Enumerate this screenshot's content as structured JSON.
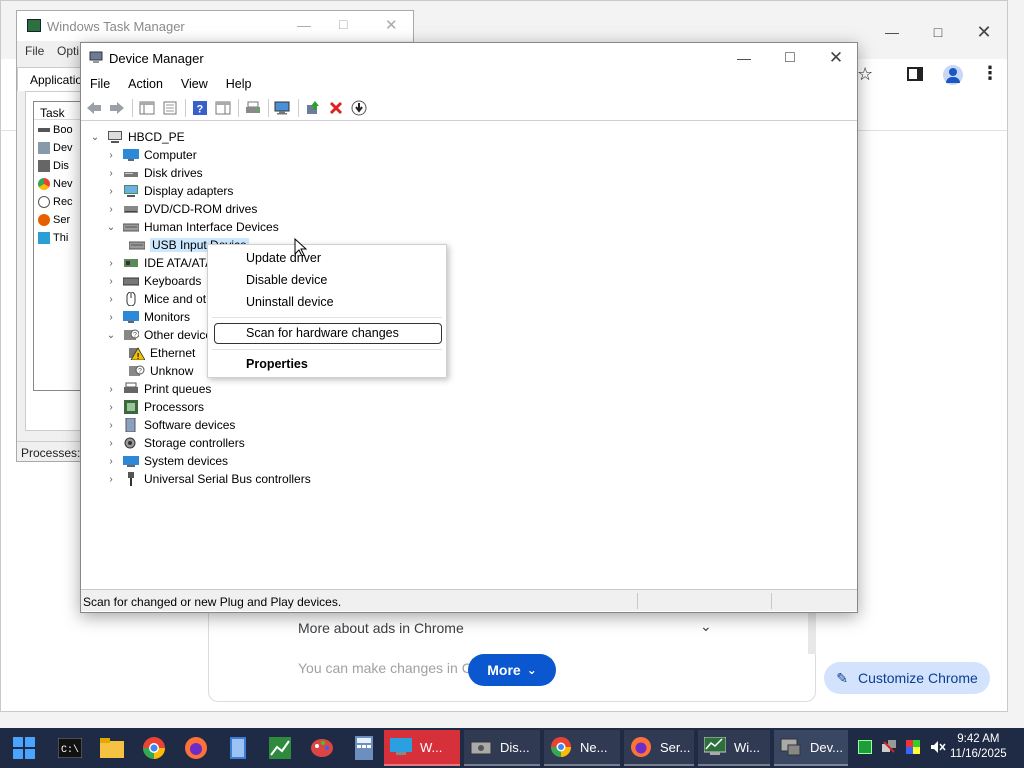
{
  "chrome": {
    "ads_row_text": "More about ads in Chrome",
    "changes_text": "You can make changes in Chro",
    "more_button": "More",
    "customize_button": "Customize Chrome",
    "colors": {
      "accent": "#0b57d0",
      "customize_bg": "#d3e3fd"
    }
  },
  "task_manager": {
    "title": "Windows Task Manager",
    "menu": [
      "File",
      "Opti"
    ],
    "tab_label": "Applicatio",
    "list_header": "Task",
    "list_items": [
      "Boo",
      "Dev",
      "Dis",
      "Nev",
      "Rec",
      "Ser",
      "Thi"
    ],
    "status_text": "Processes: "
  },
  "device_manager": {
    "title": "Device Manager",
    "menu": [
      "File",
      "Action",
      "View",
      "Help"
    ],
    "tree": {
      "root": "HBCD_PE",
      "nodes": [
        {
          "label": "Computer",
          "expanded": false
        },
        {
          "label": "Disk drives",
          "expanded": false
        },
        {
          "label": "Display adapters",
          "expanded": false
        },
        {
          "label": "DVD/CD-ROM drives",
          "expanded": false
        },
        {
          "label": "Human Interface Devices",
          "expanded": true
        },
        {
          "label": "USB Input Device",
          "child": true,
          "selected": true
        },
        {
          "label": "IDE ATA/ATA",
          "expanded": false
        },
        {
          "label": "Keyboards",
          "expanded": false
        },
        {
          "label": "Mice and ot",
          "expanded": false
        },
        {
          "label": "Monitors",
          "expanded": false
        },
        {
          "label": "Other device",
          "expanded": true
        },
        {
          "label": "Ethernet",
          "child": true
        },
        {
          "label": "Unknow",
          "child": true
        },
        {
          "label": "Print queues",
          "expanded": false
        },
        {
          "label": "Processors",
          "expanded": false
        },
        {
          "label": "Software devices",
          "expanded": false
        },
        {
          "label": "Storage controllers",
          "expanded": false
        },
        {
          "label": "System devices",
          "expanded": false
        },
        {
          "label": "Universal Serial Bus controllers",
          "expanded": false
        }
      ]
    },
    "status_text": "Scan for changed or new Plug and Play devices."
  },
  "context_menu": {
    "update_driver": "Update driver",
    "disable_device": "Disable device",
    "uninstall_device": "Uninstall device",
    "scan_hardware": "Scan for hardware changes",
    "properties": "Properties"
  },
  "taskbar": {
    "tasks": [
      "W...",
      "Dis...",
      "Ne...",
      "Ser...",
      "Wi...",
      "Dev..."
    ],
    "time": "9:42 AM",
    "date": "11/16/2025"
  }
}
